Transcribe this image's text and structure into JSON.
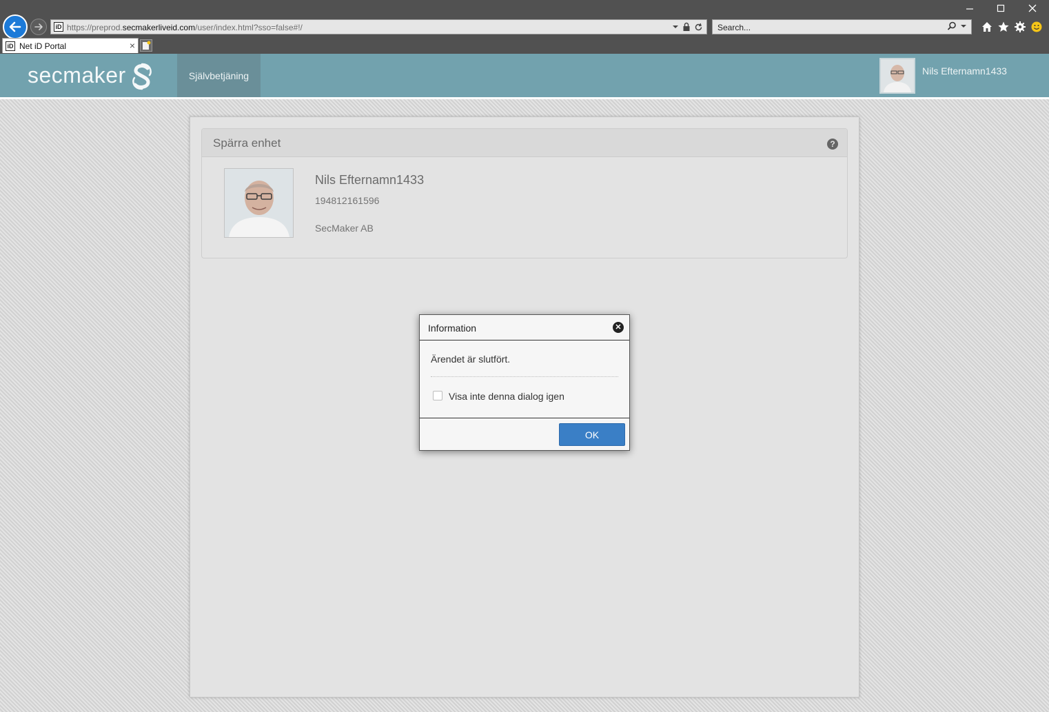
{
  "browser": {
    "url_prefix": "https://",
    "url_domain_pre": "preprod.",
    "url_domain": "secmakerliveid.com",
    "url_path": "/user/index.html?sso=false#!/",
    "search_placeholder": "Search...",
    "tab_title": "Net iD Portal",
    "favicon_text": "iD"
  },
  "header": {
    "logo": "secmaker",
    "nav_item": "Självbetjäning",
    "user_name": "Nils Efternamn1433"
  },
  "panel": {
    "title": "Spärra enhet",
    "user_name": "Nils Efternamn1433",
    "user_id": "194812161596",
    "organization": "SecMaker AB"
  },
  "dialog": {
    "title": "Information",
    "message": "Ärendet är slutfört.",
    "checkbox_label": "Visa inte denna dialog igen",
    "ok_label": "OK"
  },
  "colors": {
    "header_bg": "#72a2ae",
    "accent_button": "#3a7fc6",
    "browser_chrome": "#515151"
  }
}
